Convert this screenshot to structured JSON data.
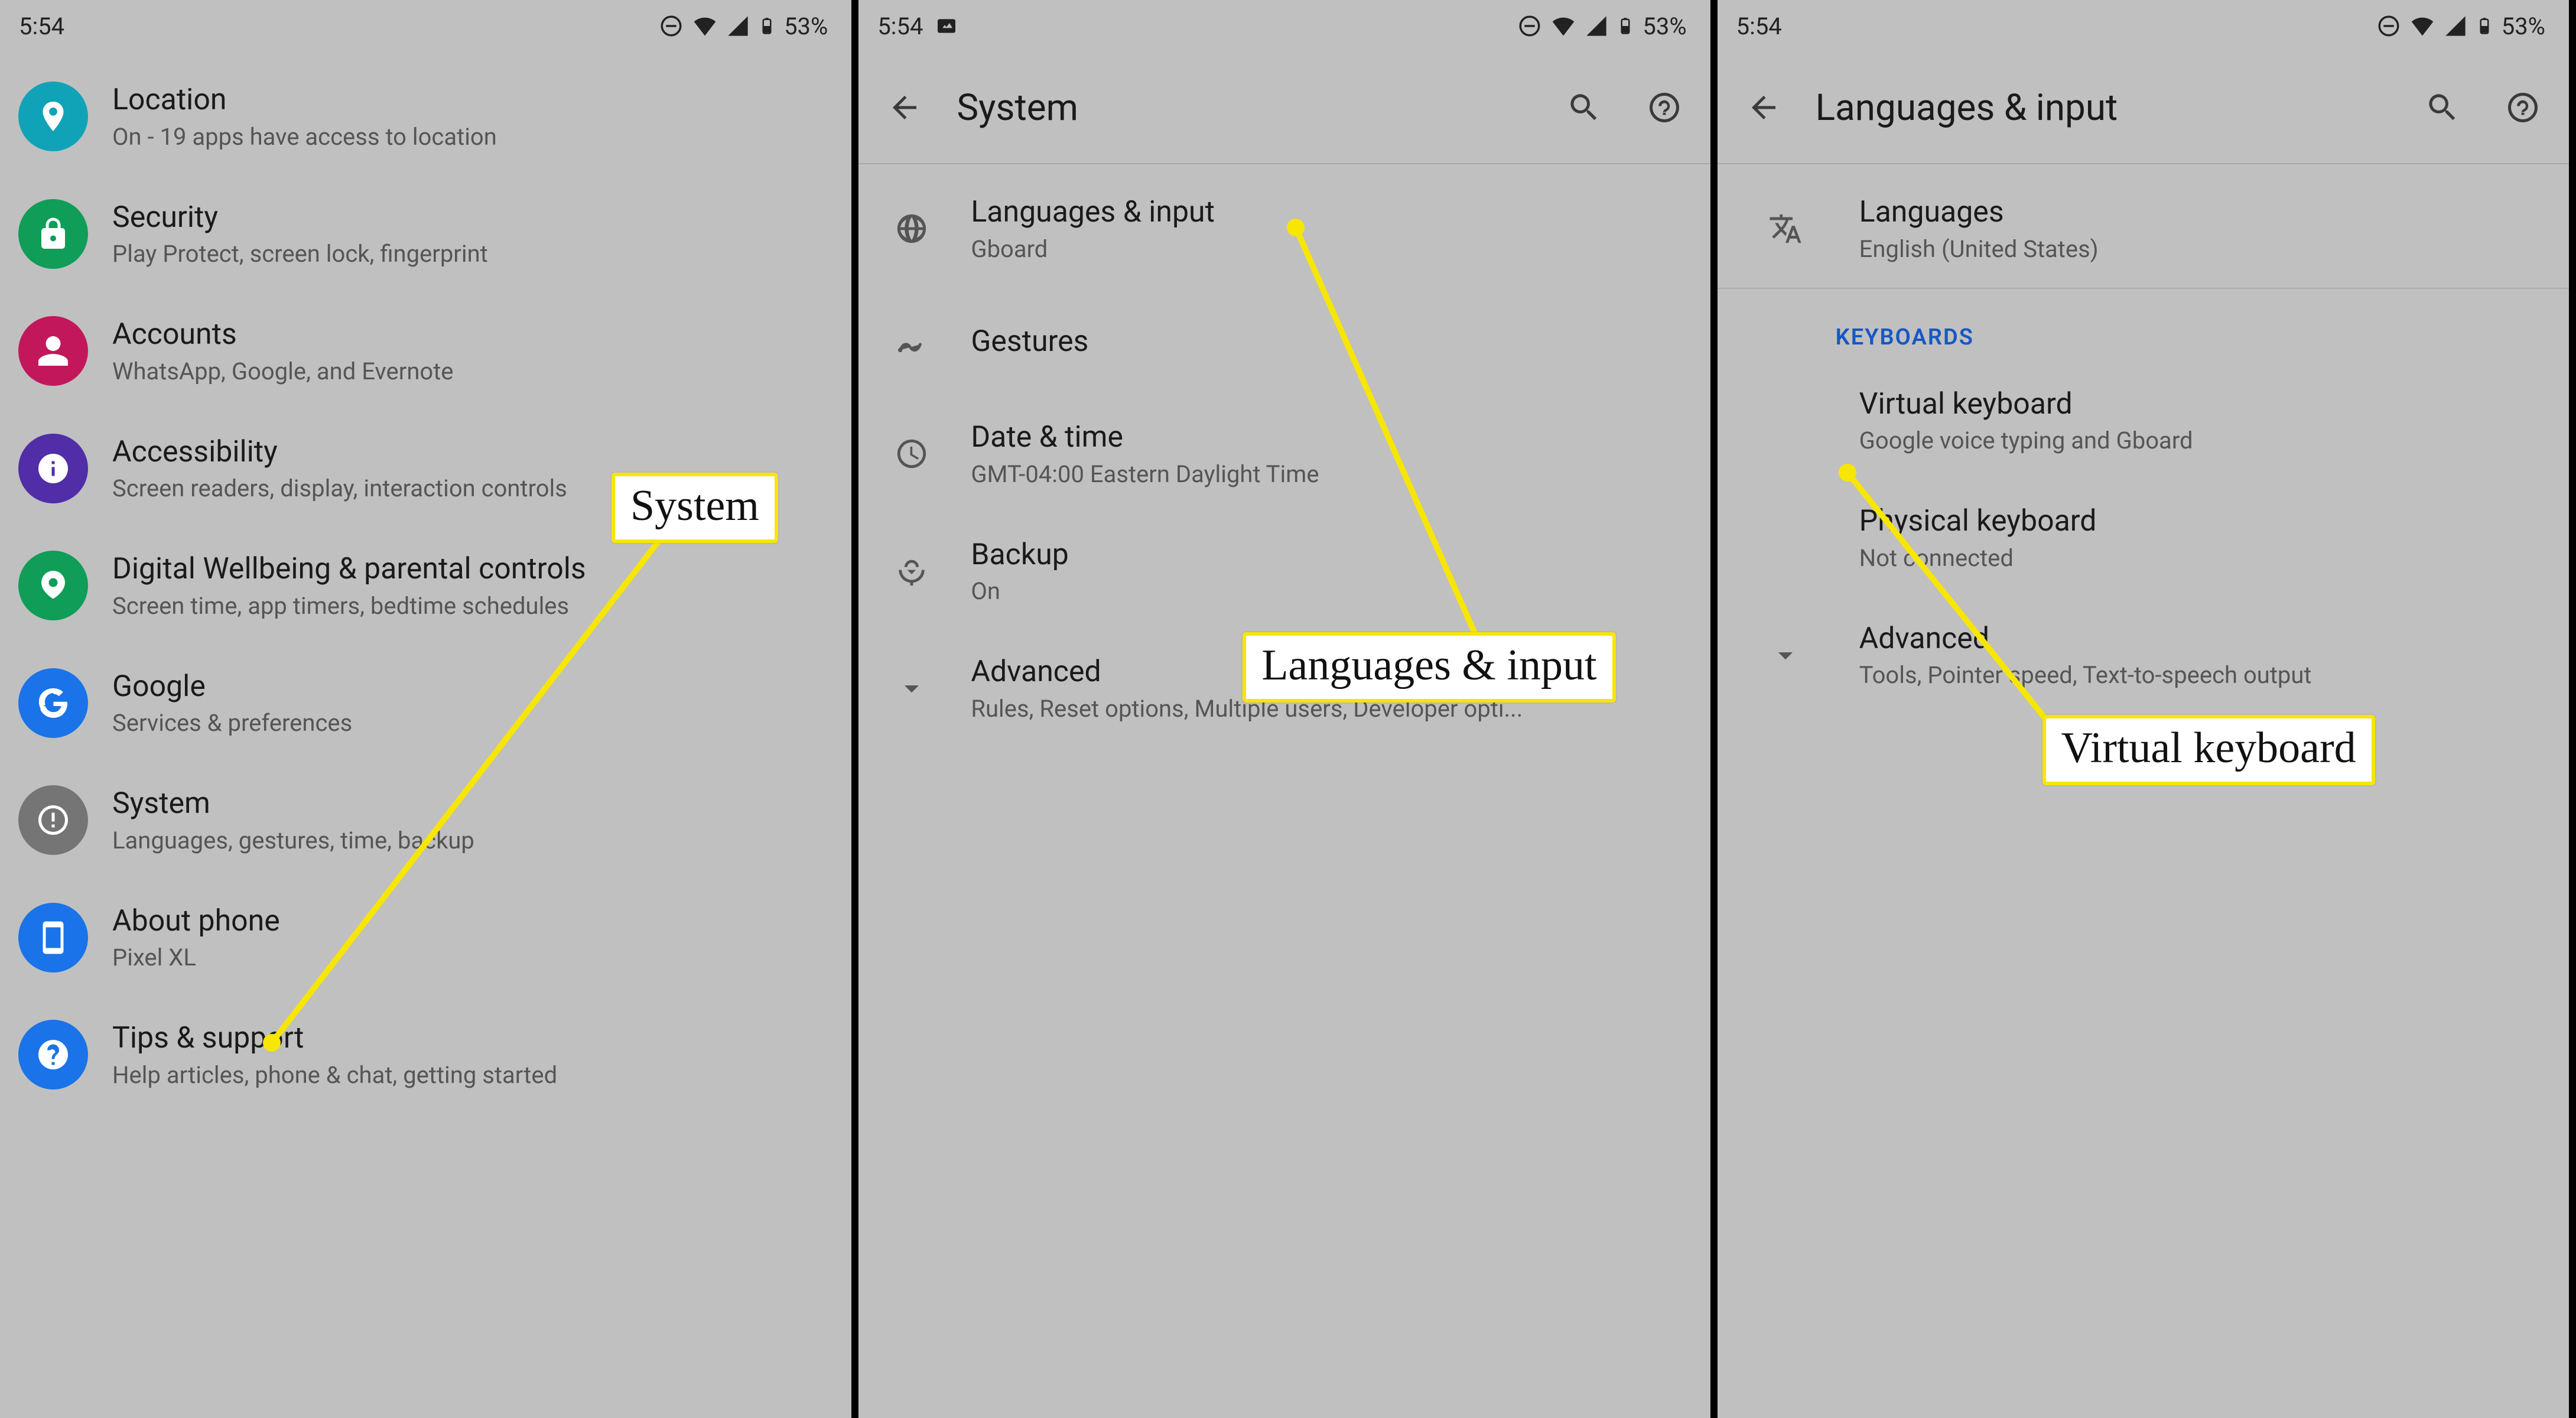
{
  "status": {
    "time": "5:54",
    "battery": "53%"
  },
  "screen1": {
    "items": [
      {
        "title": "Location",
        "subtitle": "On - 19 apps have access to location",
        "color": "#10a3b8"
      },
      {
        "title": "Security",
        "subtitle": "Play Protect, screen lock, fingerprint",
        "color": "#0f9d58"
      },
      {
        "title": "Accounts",
        "subtitle": "WhatsApp, Google, and Evernote",
        "color": "#c2185b"
      },
      {
        "title": "Accessibility",
        "subtitle": "Screen readers, display, interaction controls",
        "color": "#512da8"
      },
      {
        "title": "Digital Wellbeing & parental controls",
        "subtitle": "Screen time, app timers, bedtime schedules",
        "color": "#0f9d58"
      },
      {
        "title": "Google",
        "subtitle": "Services & preferences",
        "color": "#1a73e8"
      },
      {
        "title": "System",
        "subtitle": "Languages, gestures, time, backup",
        "color": "#757575"
      },
      {
        "title": "About phone",
        "subtitle": "Pixel XL",
        "color": "#1a73e8"
      },
      {
        "title": "Tips & support",
        "subtitle": "Help articles, phone & chat, getting started",
        "color": "#1a73e8"
      }
    ],
    "callout": "System"
  },
  "screen2": {
    "title": "System",
    "items": [
      {
        "title": "Languages & input",
        "subtitle": "Gboard"
      },
      {
        "title": "Gestures",
        "subtitle": ""
      },
      {
        "title": "Date & time",
        "subtitle": "GMT-04:00 Eastern Daylight Time"
      },
      {
        "title": "Backup",
        "subtitle": "On"
      },
      {
        "title": "Advanced",
        "subtitle": "Rules, Reset options, Multiple users, Developer opti..."
      }
    ],
    "callout": "Languages & input"
  },
  "screen3": {
    "title": "Languages & input",
    "top": {
      "title": "Languages",
      "subtitle": "English (United States)"
    },
    "section": "KEYBOARDS",
    "items": [
      {
        "title": "Virtual keyboard",
        "subtitle": "Google voice typing and Gboard"
      },
      {
        "title": "Physical keyboard",
        "subtitle": "Not connected"
      },
      {
        "title": "Advanced",
        "subtitle": "Tools, Pointer speed, Text-to-speech output"
      }
    ],
    "callout": "Virtual keyboard"
  }
}
